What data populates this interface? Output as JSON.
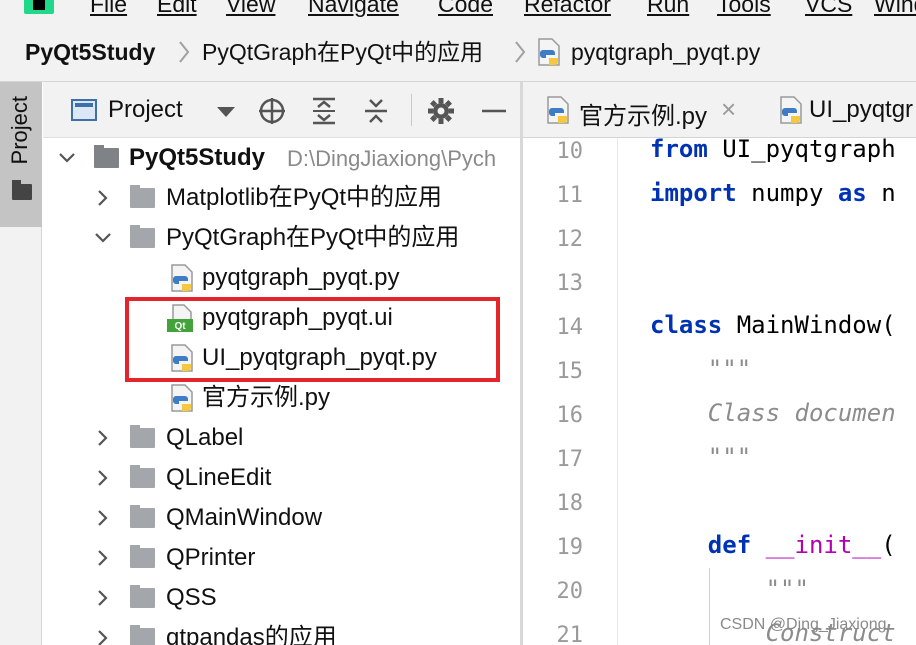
{
  "menubar": {
    "items": [
      "File",
      "Edit",
      "View",
      "Navigate",
      "Code",
      "Refactor",
      "Run",
      "Tools",
      "VCS",
      "Wind"
    ]
  },
  "breadcrumb": {
    "root": "PyQt5Study",
    "folder": "PyQtGraph在PyQt中的应用",
    "file": "pyqtgraph_pyqt.py"
  },
  "sidebar_stripe": {
    "label": "Project"
  },
  "project_panel": {
    "title": "Project",
    "tree": [
      {
        "label": "PyQt5Study",
        "path": "D:\\DingJiaxiong\\Pych",
        "type": "folder",
        "expanded": true
      },
      {
        "label": "Matplotlib在PyQt中的应用",
        "type": "folder",
        "expanded": false
      },
      {
        "label": "PyQtGraph在PyQt中的应用",
        "type": "folder",
        "expanded": true
      },
      {
        "label": "pyqtgraph_pyqt.py",
        "type": "py"
      },
      {
        "label": "pyqtgraph_pyqt.ui",
        "type": "qt",
        "badge": "Qt"
      },
      {
        "label": "UI_pyqtgraph_pyqt.py",
        "type": "py"
      },
      {
        "label": "官方示例.py",
        "type": "py"
      },
      {
        "label": "QLabel",
        "type": "folder",
        "expanded": false
      },
      {
        "label": "QLineEdit",
        "type": "folder",
        "expanded": false
      },
      {
        "label": "QMainWindow",
        "type": "folder",
        "expanded": false
      },
      {
        "label": "QPrinter",
        "type": "folder",
        "expanded": false
      },
      {
        "label": "QSS",
        "type": "folder",
        "expanded": false
      },
      {
        "label": "qtpandas的应用",
        "type": "folder",
        "expanded": false
      }
    ]
  },
  "editor": {
    "tabs": [
      {
        "label": "官方示例.py",
        "close": "×"
      },
      {
        "label": "UI_pyqtgr"
      }
    ],
    "line_numbers": [
      "10",
      "11",
      "12",
      "13",
      "14",
      "15",
      "16",
      "17",
      "18",
      "19",
      "20",
      "21"
    ],
    "code": {
      "l10_kw": "from",
      "l10_rest": " UI_pyqtgraph",
      "l11_kw": "import",
      "l11_mid": " numpy ",
      "l11_kw2": "as",
      "l11_rest": " n",
      "l14_kw": "class",
      "l14_rest": " MainWindow(",
      "l15": "    \"\"\"",
      "l16": "    Class documen",
      "l17": "    \"\"\"",
      "l19_indent": "    ",
      "l19_kw": "def",
      "l19_sp": " ",
      "l19_name": "__init__",
      "l19_rest": "(",
      "l20": "        \"\"\"",
      "l21": "        Construct"
    }
  },
  "watermark": "CSDN @Ding_Jiaxiong",
  "colors": {
    "highlight_box": "#e4252c",
    "keyword": "#0033b3",
    "docstring": "#8c8c8c",
    "dunder": "#b200b2"
  }
}
